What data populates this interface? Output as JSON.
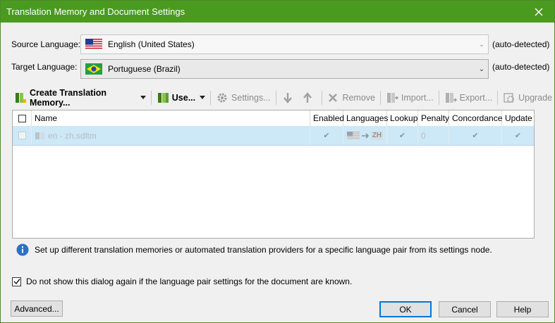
{
  "window": {
    "title": "Translation Memory and Document Settings"
  },
  "source": {
    "label": "Source Language:",
    "value": "English (United States)",
    "note": "(auto-detected)"
  },
  "target": {
    "label": "Target Language:",
    "value": "Portuguese (Brazil)",
    "note": "(auto-detected)"
  },
  "toolbar": {
    "create": "Create Translation Memory...",
    "use": "Use...",
    "settings": "Settings...",
    "remove": "Remove",
    "import": "Import...",
    "export": "Export...",
    "upgrade": "Upgrade"
  },
  "grid": {
    "columns": [
      "Name",
      "Enabled",
      "Languages",
      "Lookup",
      "Penalty",
      "Concordance",
      "Update"
    ],
    "rows": [
      {
        "name": "en - zh.sdltm",
        "target_code": "ZH",
        "penalty": "0"
      }
    ]
  },
  "info_text": "Set up different translation memories or automated translation providers for a specific language pair from its settings node.",
  "dont_show_label": "Do not show this dialog again if the language pair settings for the document are known.",
  "buttons": {
    "advanced": "Advanced...",
    "ok": "OK",
    "cancel": "Cancel",
    "help": "Help"
  },
  "colors": {
    "titlebar": "#4a9a1f",
    "selection": "#cde8f7",
    "accent": "#0078d7"
  }
}
